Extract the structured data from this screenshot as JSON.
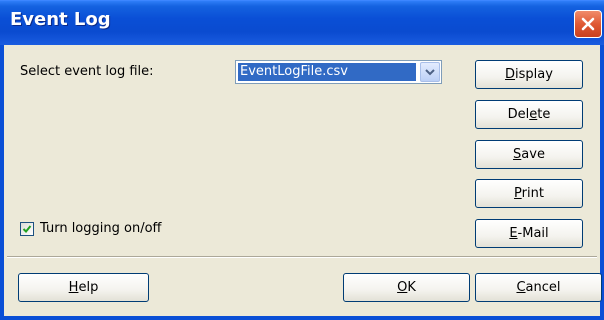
{
  "window": {
    "title": "Event Log"
  },
  "form": {
    "file_label": "Select event log file:",
    "file_select_value": "EventLogFile.csv",
    "logging_checkbox_label": "Turn logging on/off",
    "logging_checked": true
  },
  "buttons": {
    "display": {
      "prefix": "",
      "mnemonic": "D",
      "suffix": "isplay"
    },
    "delete": {
      "prefix": "Del",
      "mnemonic": "e",
      "suffix": "te"
    },
    "save": {
      "prefix": "",
      "mnemonic": "S",
      "suffix": "ave"
    },
    "print": {
      "prefix": "",
      "mnemonic": "P",
      "suffix": "rint"
    },
    "email": {
      "prefix": "",
      "mnemonic": "E",
      "suffix": "-Mail"
    },
    "help": {
      "prefix": "",
      "mnemonic": "H",
      "suffix": "elp"
    },
    "ok": {
      "prefix": "",
      "mnemonic": "O",
      "suffix": "K"
    },
    "cancel": {
      "prefix": "",
      "mnemonic": "C",
      "suffix": "ancel"
    }
  },
  "icons": {
    "close": "close-icon",
    "dropdown": "chevron-down-icon",
    "check": "checkmark-icon"
  },
  "colors": {
    "title_bar": "#0a4fd6",
    "close_button": "#e05a35",
    "selection": "#316ac5",
    "dialog_bg": "#ece9d8",
    "checkmark": "#21a121"
  }
}
